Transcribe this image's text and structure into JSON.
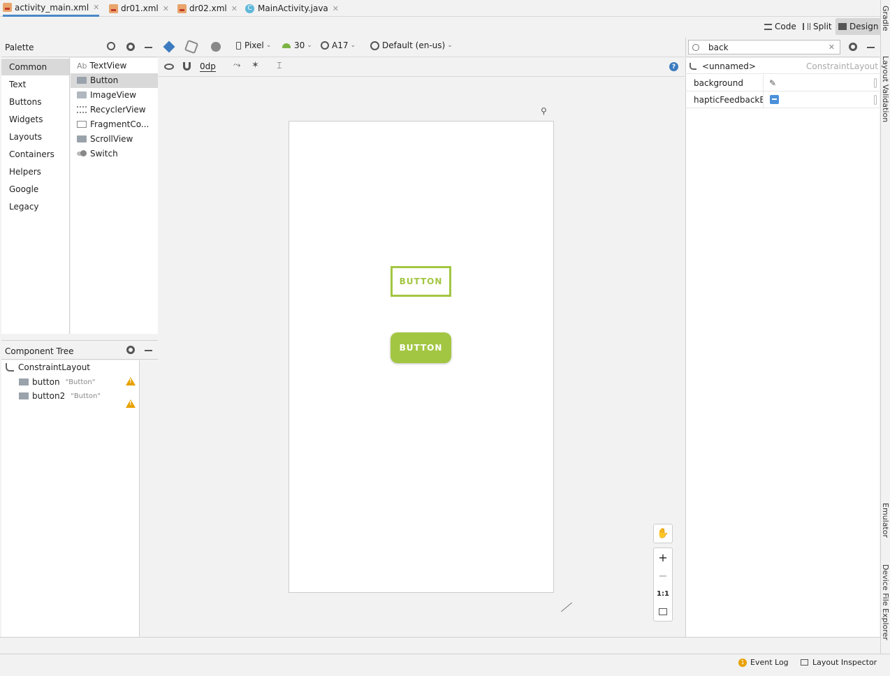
{
  "tabs": [
    {
      "label": "activity_main.xml",
      "active": true,
      "icon": "xml-file-icon"
    },
    {
      "label": "dr01.xml",
      "active": false,
      "icon": "xml-file-icon"
    },
    {
      "label": "dr02.xml",
      "active": false,
      "icon": "xml-file-icon"
    },
    {
      "label": "MainActivity.java",
      "active": false,
      "icon": "java-class-icon"
    }
  ],
  "view_modes": {
    "code": "Code",
    "split": "Split",
    "design": "Design",
    "selected": "Design"
  },
  "palette": {
    "title": "Palette",
    "categories": [
      "Common",
      "Text",
      "Buttons",
      "Widgets",
      "Layouts",
      "Containers",
      "Helpers",
      "Google",
      "Legacy"
    ],
    "selected_category": "Common",
    "items": [
      {
        "label": "TextView",
        "prefix": "Ab"
      },
      {
        "label": "Button"
      },
      {
        "label": "ImageView"
      },
      {
        "label": "RecyclerView"
      },
      {
        "label": "FragmentCo..."
      },
      {
        "label": "ScrollView"
      },
      {
        "label": "Switch"
      }
    ],
    "selected_item": "Button"
  },
  "toolbar": {
    "device": "Pixel",
    "api": "30",
    "theme": "A17",
    "locale": "Default (en-us)",
    "margin": "0dp"
  },
  "component_tree": {
    "title": "Component Tree",
    "root": "ConstraintLayout",
    "children": [
      {
        "id": "button",
        "text": "\"Button\""
      },
      {
        "id": "button2",
        "text": "\"Button\""
      }
    ]
  },
  "design_surface": {
    "button_outlined_label": "BUTTON",
    "button_filled_label": "BUTTON",
    "accent_color": "#a3c642"
  },
  "zoom_controls": {
    "plus": "+",
    "minus": "−",
    "one_to_one": "1:1"
  },
  "attributes": {
    "search_value": "back",
    "component_name": "<unnamed>",
    "component_type": "ConstraintLayout",
    "rows": [
      {
        "name": "background"
      },
      {
        "name": "hapticFeedbackEn..."
      }
    ]
  },
  "side_tabs": {
    "gradle": "Gradle",
    "layout_validation": "Layout Validation",
    "emulator": "Emulator",
    "device_file_explorer": "Device File Explorer"
  },
  "status": {
    "event_log": "Event Log",
    "event_count": "1",
    "layout_inspector": "Layout Inspector"
  }
}
